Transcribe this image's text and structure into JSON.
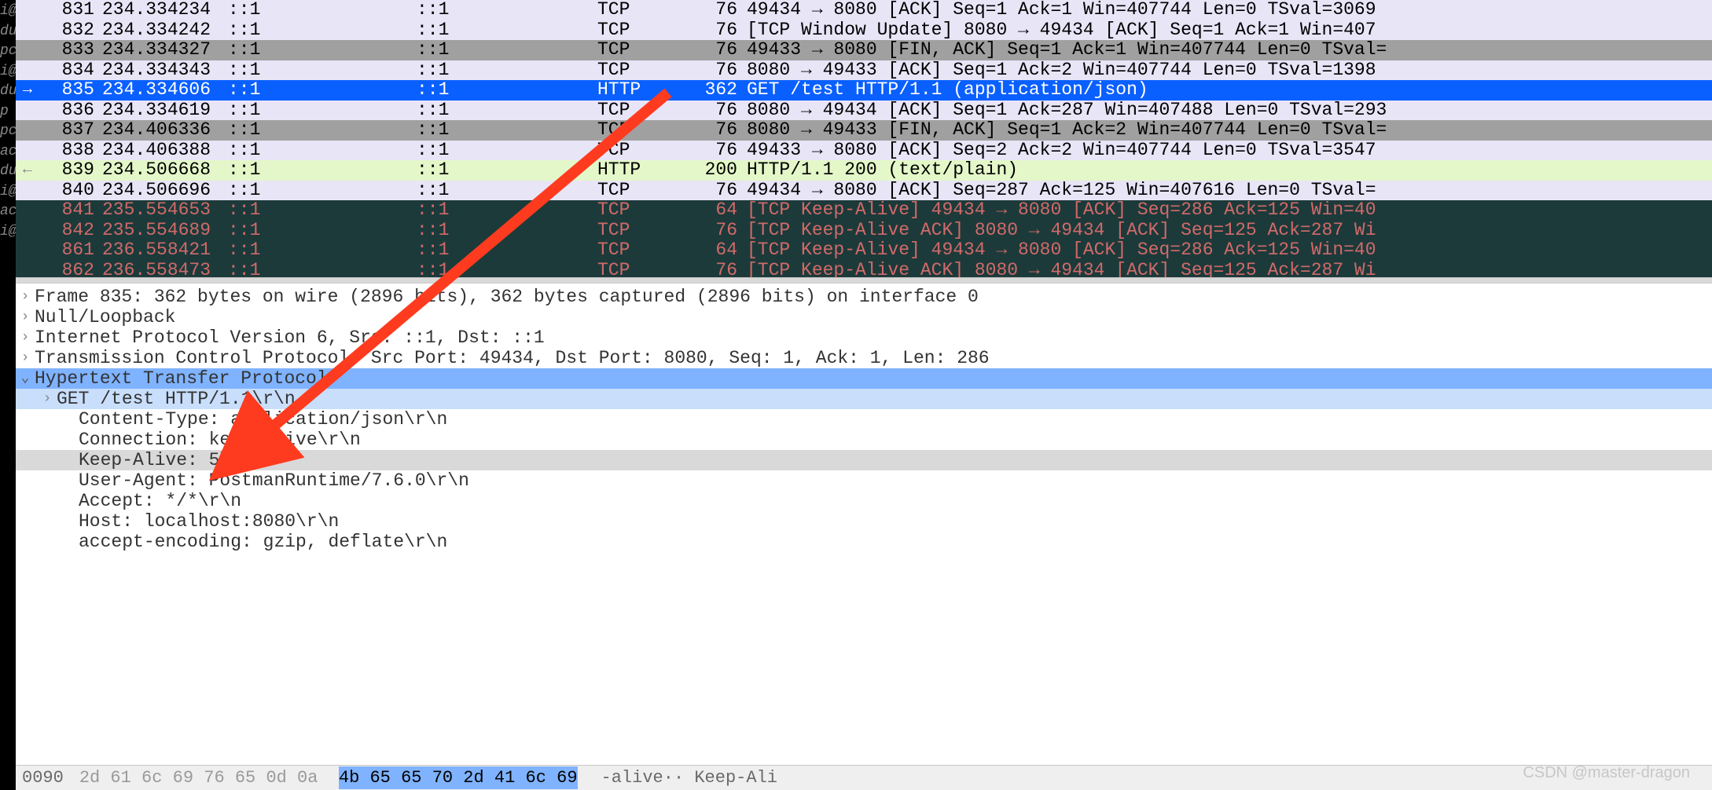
{
  "left_strip_lines": [
    "",
    "",
    "",
    "i@",
    "du",
    "",
    "pc",
    "i@",
    "du",
    "p",
    "pc",
    "ac",
    "",
    "du",
    "i@",
    "",
    "ac",
    " ",
    "i@",
    ""
  ],
  "packets": [
    {
      "no": "831",
      "time": "234.334234",
      "src": "::1",
      "dst": "::1",
      "proto": "TCP",
      "len": "76",
      "info": "49434 → 8080 [ACK] Seq=1 Ack=1 Win=407744 Len=0 TSval=3069",
      "theme": "lavender",
      "marker": ""
    },
    {
      "no": "832",
      "time": "234.334242",
      "src": "::1",
      "dst": "::1",
      "proto": "TCP",
      "len": "76",
      "info": "[TCP Window Update] 8080 → 49434 [ACK] Seq=1 Ack=1 Win=407",
      "theme": "lavender",
      "marker": ""
    },
    {
      "no": "833",
      "time": "234.334327",
      "src": "::1",
      "dst": "::1",
      "proto": "TCP",
      "len": "76",
      "info": "49433 → 8080 [FIN, ACK] Seq=1 Ack=1 Win=407744 Len=0 TSval=",
      "theme": "gray",
      "marker": ""
    },
    {
      "no": "834",
      "time": "234.334343",
      "src": "::1",
      "dst": "::1",
      "proto": "TCP",
      "len": "76",
      "info": "8080 → 49433 [ACK] Seq=1 Ack=2 Win=407744 Len=0 TSval=1398",
      "theme": "lavender",
      "marker": ""
    },
    {
      "no": "835",
      "time": "234.334606",
      "src": "::1",
      "dst": "::1",
      "proto": "HTTP",
      "len": "362",
      "info": "GET /test HTTP/1.1  (application/json)",
      "theme": "selected",
      "marker": "→"
    },
    {
      "no": "836",
      "time": "234.334619",
      "src": "::1",
      "dst": "::1",
      "proto": "TCP",
      "len": "76",
      "info": "8080 → 49434 [ACK] Seq=1 Ack=287 Win=407488 Len=0 TSval=293",
      "theme": "lavender",
      "marker": ""
    },
    {
      "no": "837",
      "time": "234.406336",
      "src": "::1",
      "dst": "::1",
      "proto": "TCP",
      "len": "76",
      "info": "8080 → 49433 [FIN, ACK] Seq=1 Ack=2 Win=407744 Len=0 TSval=",
      "theme": "gray",
      "marker": ""
    },
    {
      "no": "838",
      "time": "234.406388",
      "src": "::1",
      "dst": "::1",
      "proto": "TCP",
      "len": "76",
      "info": "49433 → 8080 [ACK] Seq=2 Ack=2 Win=407744 Len=0 TSval=3547",
      "theme": "lavender",
      "marker": ""
    },
    {
      "no": "839",
      "time": "234.506668",
      "src": "::1",
      "dst": "::1",
      "proto": "HTTP",
      "len": "200",
      "info": "HTTP/1.1 200   (text/plain)",
      "theme": "green",
      "marker": "←"
    },
    {
      "no": "840",
      "time": "234.506696",
      "src": "::1",
      "dst": "::1",
      "proto": "TCP",
      "len": "76",
      "info": "49434 → 8080 [ACK] Seq=287 Ack=125 Win=407616 Len=0 TSval=",
      "theme": "lavender",
      "marker": ""
    },
    {
      "no": "841",
      "time": "235.554653",
      "src": "::1",
      "dst": "::1",
      "proto": "TCP",
      "len": "64",
      "info": "[TCP Keep-Alive] 49434 → 8080 [ACK] Seq=286 Ack=125 Win=40",
      "theme": "dark",
      "marker": ""
    },
    {
      "no": "842",
      "time": "235.554689",
      "src": "::1",
      "dst": "::1",
      "proto": "TCP",
      "len": "76",
      "info": "[TCP Keep-Alive ACK] 8080 → 49434 [ACK] Seq=125 Ack=287 Wi",
      "theme": "dark",
      "marker": ""
    },
    {
      "no": "861",
      "time": "236.558421",
      "src": "::1",
      "dst": "::1",
      "proto": "TCP",
      "len": "64",
      "info": "[TCP Keep-Alive] 49434 → 8080 [ACK] Seq=286 Ack=125 Win=40",
      "theme": "dark",
      "marker": ""
    },
    {
      "no": "862",
      "time": "236.558473",
      "src": "::1",
      "dst": "::1",
      "proto": "TCP",
      "len": "76",
      "info": "[TCP Keep-Alive ACK] 8080 → 49434 [ACK] Seq=125 Ack=287 Wi",
      "theme": "dark",
      "marker": ""
    }
  ],
  "tree": [
    {
      "arrow": ">",
      "indent": 0,
      "text": "Frame 835: 362 bytes on wire (2896 bits), 362 bytes captured (2896 bits) on interface 0",
      "cls": ""
    },
    {
      "arrow": ">",
      "indent": 0,
      "text": "Null/Loopback",
      "cls": ""
    },
    {
      "arrow": ">",
      "indent": 0,
      "text": "Internet Protocol Version 6, Src: ::1, Dst: ::1",
      "cls": ""
    },
    {
      "arrow": ">",
      "indent": 0,
      "text": "Transmission Control Protocol, Src Port: 49434, Dst Port: 8080, Seq: 1, Ack: 1, Len: 286",
      "cls": ""
    },
    {
      "arrow": "v",
      "indent": 0,
      "text": "Hypertext Transfer Protocol",
      "cls": "sel-block"
    },
    {
      "arrow": ">",
      "indent": 1,
      "text": "GET /test HTTP/1.1\\r\\n",
      "cls": "sel-light"
    },
    {
      "arrow": "",
      "indent": 2,
      "text": "Content-Type: application/json\\r\\n",
      "cls": ""
    },
    {
      "arrow": "",
      "indent": 2,
      "text": "Connection: keep-alive\\r\\n",
      "cls": ""
    },
    {
      "arrow": "",
      "indent": 2,
      "text": "Keep-Alive: 5\\r\\n",
      "cls": "grayband"
    },
    {
      "arrow": "",
      "indent": 2,
      "text": "User-Agent: PostmanRuntime/7.6.0\\r\\n",
      "cls": ""
    },
    {
      "arrow": "",
      "indent": 2,
      "text": "Accept: */*\\r\\n",
      "cls": ""
    },
    {
      "arrow": "",
      "indent": 2,
      "text": "Host: localhost:8080\\r\\n",
      "cls": ""
    },
    {
      "arrow": "",
      "indent": 2,
      "text": "accept-encoding: gzip, deflate\\r\\n",
      "cls": ""
    }
  ],
  "hex": {
    "offset": "0090",
    "dim_bytes": "2d 61 6c 69 76 65 0d 0a  ",
    "hl_bytes": "4b 65 65 70 2d 41 6c 69",
    "ascii": "-alive·· Keep-Ali"
  },
  "watermark": "CSDN @master-dragon",
  "annotation_color": "#ff3b1f"
}
